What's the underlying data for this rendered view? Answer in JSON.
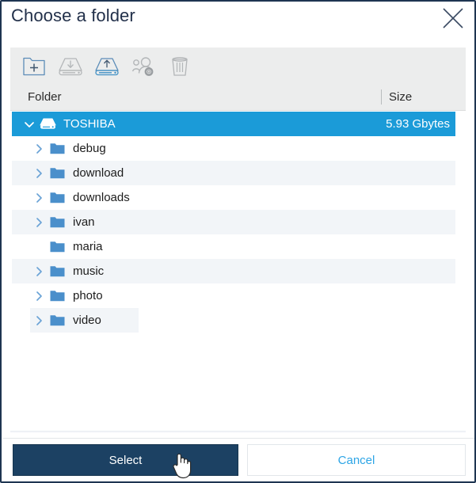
{
  "dialog": {
    "title": "Choose a folder",
    "close_icon": "close-icon"
  },
  "toolbar": {
    "buttons": [
      {
        "name": "new-folder-button",
        "icon": "folder-plus-icon",
        "enabled": true
      },
      {
        "name": "mount-drive-button",
        "icon": "drive-download-icon",
        "enabled": false
      },
      {
        "name": "unmount-drive-button",
        "icon": "drive-upload-icon",
        "enabled": true
      },
      {
        "name": "manage-users-button",
        "icon": "users-gear-icon",
        "enabled": false
      },
      {
        "name": "delete-button",
        "icon": "trash-icon",
        "enabled": false
      }
    ]
  },
  "columns": {
    "folder": "Folder",
    "size": "Size"
  },
  "tree": {
    "rows": [
      {
        "label": "TOSHIBA",
        "size": "5.93 Gbytes",
        "icon": "hard-drive-icon",
        "depth": 0,
        "expandable": true,
        "expanded": true,
        "selected": true,
        "alt": false,
        "clipped": false
      },
      {
        "label": "debug",
        "size": "",
        "icon": "folder-icon",
        "depth": 1,
        "expandable": true,
        "expanded": false,
        "selected": false,
        "alt": false,
        "clipped": false
      },
      {
        "label": "download",
        "size": "",
        "icon": "folder-icon",
        "depth": 1,
        "expandable": true,
        "expanded": false,
        "selected": false,
        "alt": true,
        "clipped": false
      },
      {
        "label": "downloads",
        "size": "",
        "icon": "folder-icon",
        "depth": 1,
        "expandable": true,
        "expanded": false,
        "selected": false,
        "alt": false,
        "clipped": false
      },
      {
        "label": "ivan",
        "size": "",
        "icon": "folder-icon",
        "depth": 1,
        "expandable": true,
        "expanded": false,
        "selected": false,
        "alt": true,
        "clipped": false
      },
      {
        "label": "maria",
        "size": "",
        "icon": "folder-icon",
        "depth": 1,
        "expandable": false,
        "expanded": false,
        "selected": false,
        "alt": false,
        "clipped": false
      },
      {
        "label": "music",
        "size": "",
        "icon": "folder-icon",
        "depth": 1,
        "expandable": true,
        "expanded": false,
        "selected": false,
        "alt": true,
        "clipped": false
      },
      {
        "label": "photo",
        "size": "",
        "icon": "folder-icon",
        "depth": 1,
        "expandable": true,
        "expanded": false,
        "selected": false,
        "alt": false,
        "clipped": false
      },
      {
        "label": "video",
        "size": "",
        "icon": "folder-icon",
        "depth": 1,
        "expandable": true,
        "expanded": false,
        "selected": false,
        "alt": true,
        "clipped": true
      }
    ]
  },
  "footer": {
    "select_label": "Select",
    "cancel_label": "Cancel"
  },
  "cursor": {
    "type": "pointing-hand-cursor"
  },
  "colors": {
    "dialog_border": "#1e3551",
    "title_text": "#22304a",
    "toolbar_bg": "#eceded",
    "selection_blue": "#1b9bd8",
    "row_alt": "#f2f5f8",
    "folder_blue": "#4a8fcb",
    "icon_enabled": "#5b8cb8",
    "icon_disabled": "#b3b6b8",
    "select_bg": "#1c4163",
    "cancel_text": "#2da5e6"
  }
}
